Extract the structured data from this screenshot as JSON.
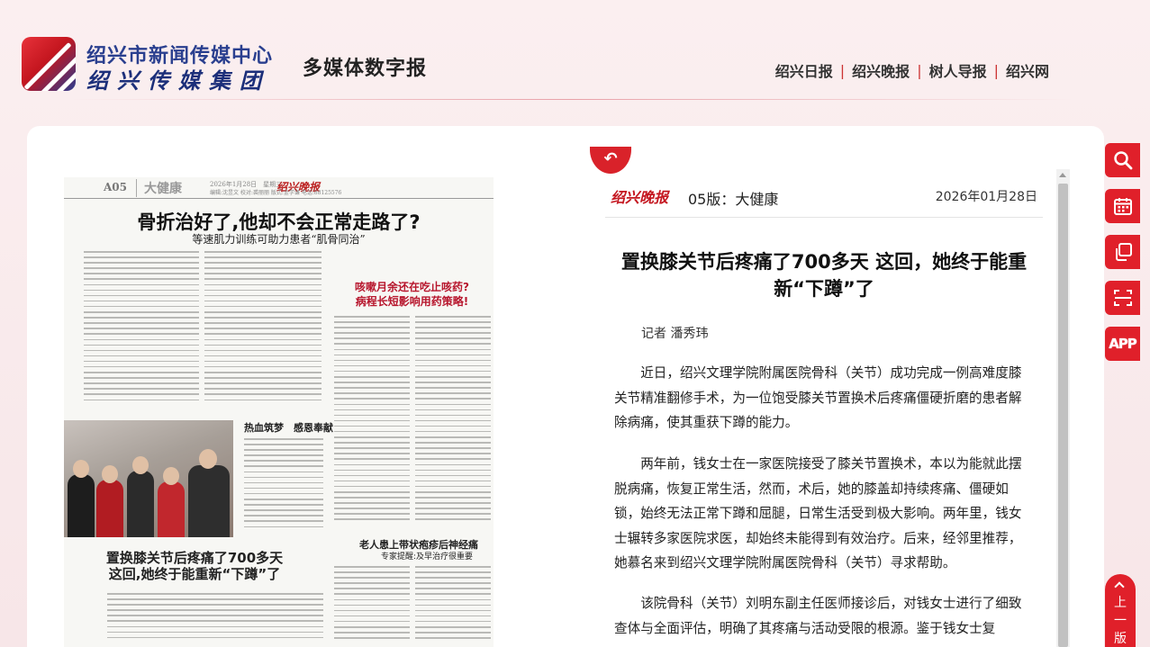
{
  "header": {
    "org_name": "绍兴市新闻传媒中心",
    "group_name": "绍兴传媒集团",
    "site_title": "多媒体数字报",
    "links": [
      {
        "label": "绍兴日报"
      },
      {
        "label": "绍兴晚报"
      },
      {
        "label": "树人导报"
      },
      {
        "label": "绍兴网"
      }
    ]
  },
  "newspaper": {
    "page_code": "A05",
    "section": "大健康",
    "date_line": "2026年1月28日　星期三",
    "masthead": "绍兴晚报",
    "editor_line": "编辑:沈昱文 校对:裘丽丽 版式:金学谦 电话:88125576",
    "headline": "骨折治好了,他却不会正常走路了?",
    "subhead": "等速肌力训练可助力患者“肌骨同治”",
    "story2_title_1": "咳嗽月余还在吃止咳药?",
    "story2_title_2": "病程长短影响用药策略!",
    "photo_caption_title": "热血筑梦　感恩奉献",
    "story3_title_1": "置换膝关节后疼痛了700多天",
    "story3_title_2": "这回,她终于能重新“下蹲”了",
    "story4_title": "老人患上带状疱疹后神经痛",
    "story4_sub": "专家提醒:及早治疗很重要"
  },
  "article": {
    "masthead": "绍兴晚报",
    "page_label": "05版：大健康",
    "date": "2026年01月28日",
    "title": "置换膝关节后疼痛了700多天 这回，她终于能重新“下蹲”了",
    "byline": "记者 潘秀玮",
    "paragraphs": [
      "近日，绍兴文理学院附属医院骨科（关节）成功完成一例高难度膝关节精准翻修手术，为一位饱受膝关节置换术后疼痛僵硬折磨的患者解除病痛，使其重获下蹲的能力。",
      "两年前，钱女士在一家医院接受了膝关节置换术，本以为能就此摆脱病痛，恢复正常生活，然而，术后，她的膝盖却持续疼痛、僵硬如锁，始终无法正常下蹲和屈腿，日常生活受到极大影响。两年里，钱女士辗转多家医院求医，却始终未能得到有效治疗。后来，经邻里推荐，她慕名来到绍兴文理学院附属医院骨科（关节）寻求帮助。",
      "该院骨科（关节）刘明东副主任医师接诊后，对钱女士进行了细致查体与全面评估，明确了其疼痛与活动受限的根源。鉴于钱女士复"
    ]
  },
  "toolbar": {
    "search": "search",
    "calendar": "calendar",
    "copy": "copy",
    "scan": "scan",
    "app_label": "APP",
    "prev_label": "上一版"
  },
  "colors": {
    "accent": "#e0202a",
    "brand_blue": "#2a3f8f"
  }
}
